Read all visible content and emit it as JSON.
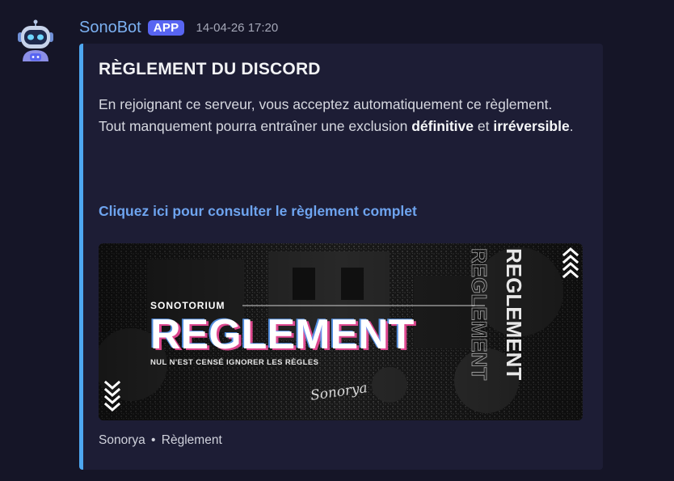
{
  "message": {
    "author": "SonoBot",
    "badge": "APP",
    "timestamp": "14-04-26 17:20"
  },
  "embed": {
    "accent_color": "#4ea7f0",
    "title": "RÈGLEMENT DU DISCORD",
    "description": {
      "line1": "En rejoignant ce serveur, vous acceptez automatiquement ce règlement.",
      "line2_before": "Tout manquement pourra entraîner une exclusion ",
      "line2_bold1": "définitive",
      "line2_middle": " et ",
      "line2_bold2": "irréversible",
      "line2_after": "."
    },
    "link_text": "Cliquez ici pour consulter le règlement complet",
    "image": {
      "kicker": "SONOTORIUM",
      "headline": "REGLEMENT",
      "subtitle": "NUL N'EST CENSÉ IGNORER LES RÈGLES",
      "signature": "Sonorya",
      "vertical_text": "REGLEMENT",
      "icons": [
        "chevrons-up-icon",
        "chevrons-down-icon"
      ]
    },
    "footer": {
      "server": "Sonorya",
      "separator": "•",
      "channel": "Règlement"
    }
  }
}
